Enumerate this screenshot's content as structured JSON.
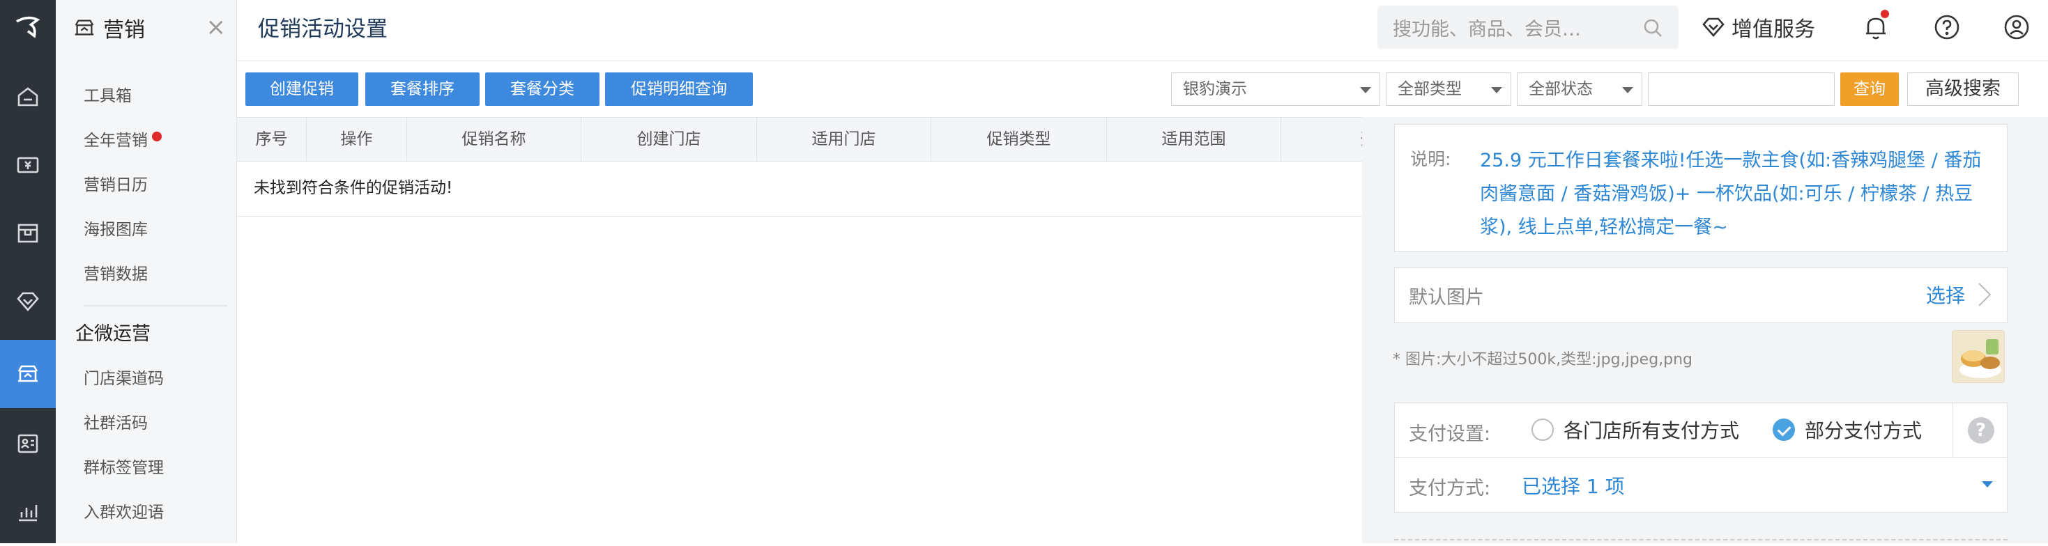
{
  "rail": {
    "items": [
      "home",
      "wallet",
      "box",
      "diamond",
      "marketing",
      "vcard",
      "chart"
    ],
    "active": "marketing"
  },
  "menu": {
    "title": "营销",
    "items": [
      {
        "label": "工具箱"
      },
      {
        "label": "全年营销"
      },
      {
        "label": "营销日历"
      },
      {
        "label": "海报图库"
      },
      {
        "label": "营销数据"
      }
    ],
    "group": "企微运营",
    "group_items": [
      {
        "label": "门店渠道码"
      },
      {
        "label": "社群活码"
      },
      {
        "label": "群标签管理"
      },
      {
        "label": "入群欢迎语"
      }
    ]
  },
  "header": {
    "title": "促销活动设置",
    "search_placeholder": "搜功能、商品、会员…",
    "vas_label": "增值服务"
  },
  "toolbar": {
    "buttons": [
      "创建促销",
      "套餐排序",
      "套餐分类",
      "促销明细查询"
    ],
    "store_select": "银豹演示",
    "type_select": "全部类型",
    "status_select": "全部状态",
    "query_label": "查询",
    "advanced_label": "高级搜索"
  },
  "table": {
    "columns": [
      "序号",
      "操作",
      "促销名称",
      "创建门店",
      "适用门店",
      "促销类型",
      "适用范围",
      "开"
    ],
    "empty_text": "未找到符合条件的促销活动!"
  },
  "panel": {
    "desc_label": "说明:",
    "desc_text": "25.9 元工作日套餐来啦!任选一款主食(如:香辣鸡腿堡 / 番茄肉酱意面 / 香菇滑鸡饭)+ 一杯饮品(如:可乐 / 柠檬茶 / 热豆浆), 线上点单,轻松搞定一餐~",
    "image_label": "默认图片",
    "image_select": "选择",
    "image_hint": "* 图片:大小不超过500k,类型:jpg,jpeg,png",
    "pay_label": "支付设置:",
    "pay_options": [
      "各门店所有支付方式",
      "部分支付方式"
    ],
    "pay_selected": "部分支付方式",
    "pay_method_label": "支付方式:",
    "pay_method_value": "已选择 1 项"
  },
  "colors": {
    "rail_bg": "#2d3338",
    "accent": "#3c89de",
    "query": "#f0a029",
    "link": "#2e87d4"
  }
}
